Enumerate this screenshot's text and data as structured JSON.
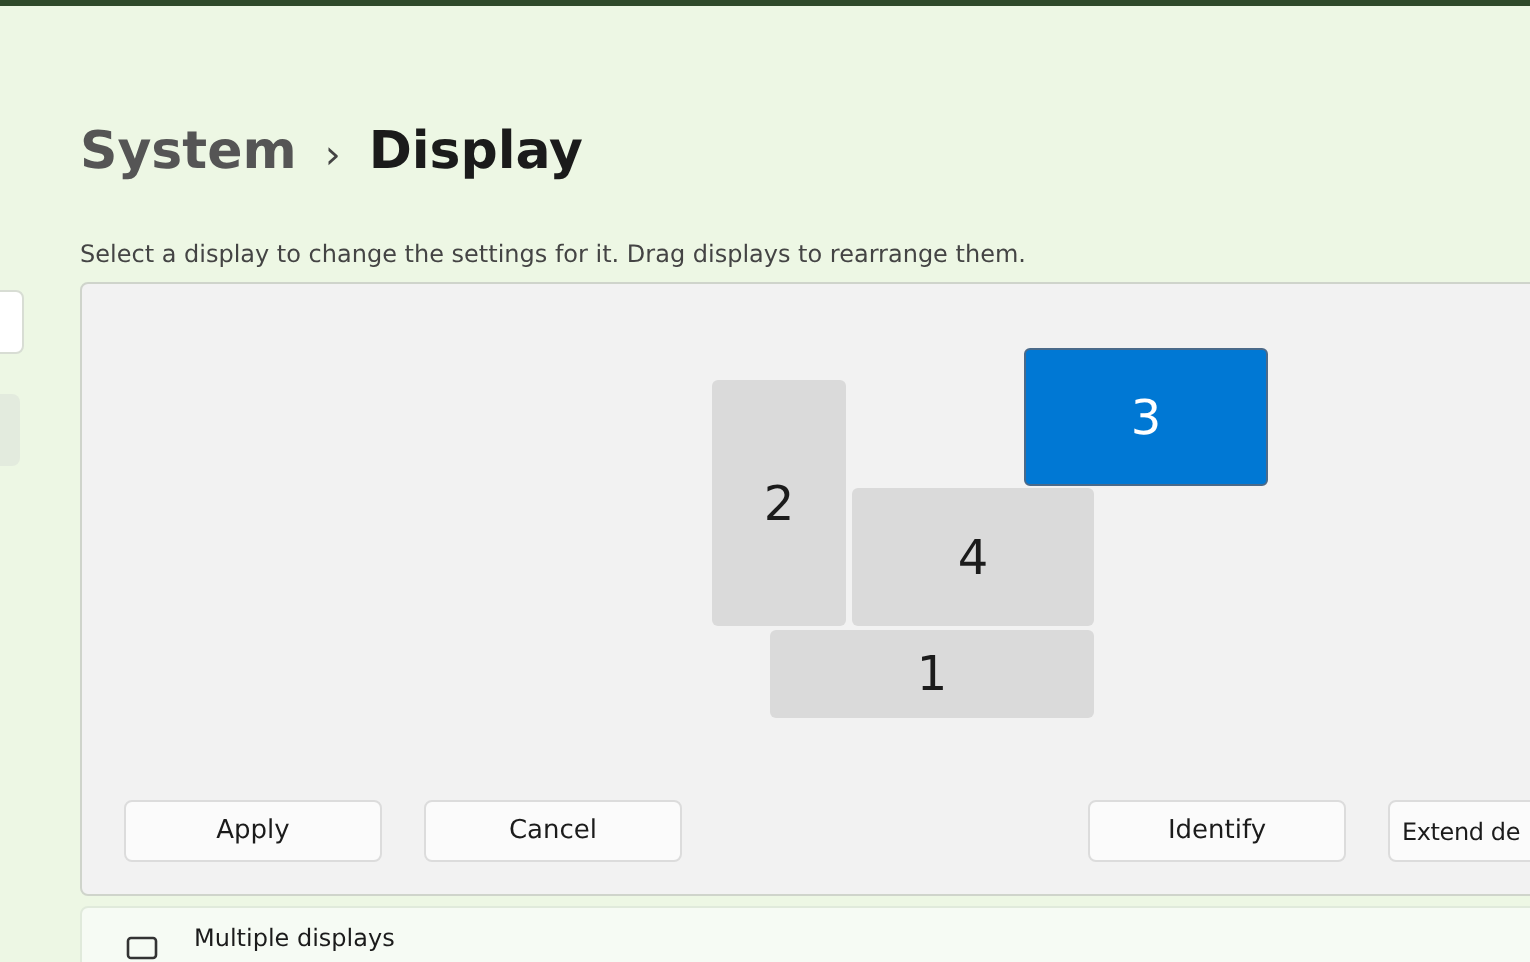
{
  "breadcrumb": {
    "parent": "System",
    "separator": "›",
    "current": "Display"
  },
  "description": "Select a display to change the settings for it. Drag displays to rearrange them.",
  "displays": [
    {
      "label": "2",
      "selected": false
    },
    {
      "label": "4",
      "selected": false
    },
    {
      "label": "3",
      "selected": true
    },
    {
      "label": "1",
      "selected": false
    }
  ],
  "left_buttons": [
    "Apply",
    "Cancel"
  ],
  "right_buttons": [
    "Identify",
    "Extend de"
  ],
  "multiple_displays": {
    "label": "Multiple displays"
  }
}
